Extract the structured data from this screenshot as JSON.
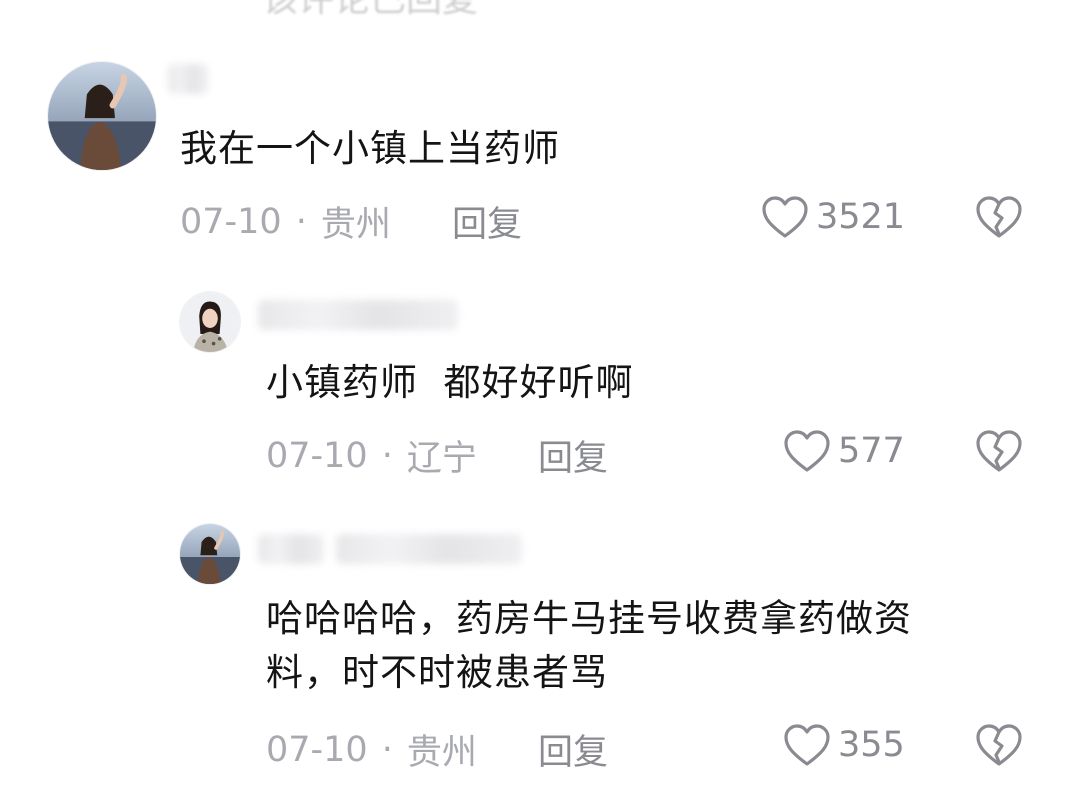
{
  "top_fragment": "该评论已回复",
  "comments": [
    {
      "text": "我在一个小镇上当药师",
      "date": "07-10",
      "separator": "·",
      "location": "贵州",
      "reply_label": "回复",
      "likes": "3521"
    },
    {
      "text": "小镇药师  都好好听啊",
      "date": "07-10",
      "separator": "·",
      "location": "辽宁",
      "reply_label": "回复",
      "likes": "577"
    },
    {
      "text_line1": "哈哈哈哈，药房牛马挂号收费拿药做资",
      "text_line2": "料，时不时被患者骂",
      "date": "07-10",
      "separator": "·",
      "location": "贵州",
      "reply_label": "回复",
      "likes": "355"
    }
  ],
  "icons": {
    "like": "heart-outline-icon",
    "dislike": "broken-heart-icon"
  },
  "colors": {
    "text": "#141414",
    "meta": "#a9aab0",
    "action": "#8a8b91"
  }
}
